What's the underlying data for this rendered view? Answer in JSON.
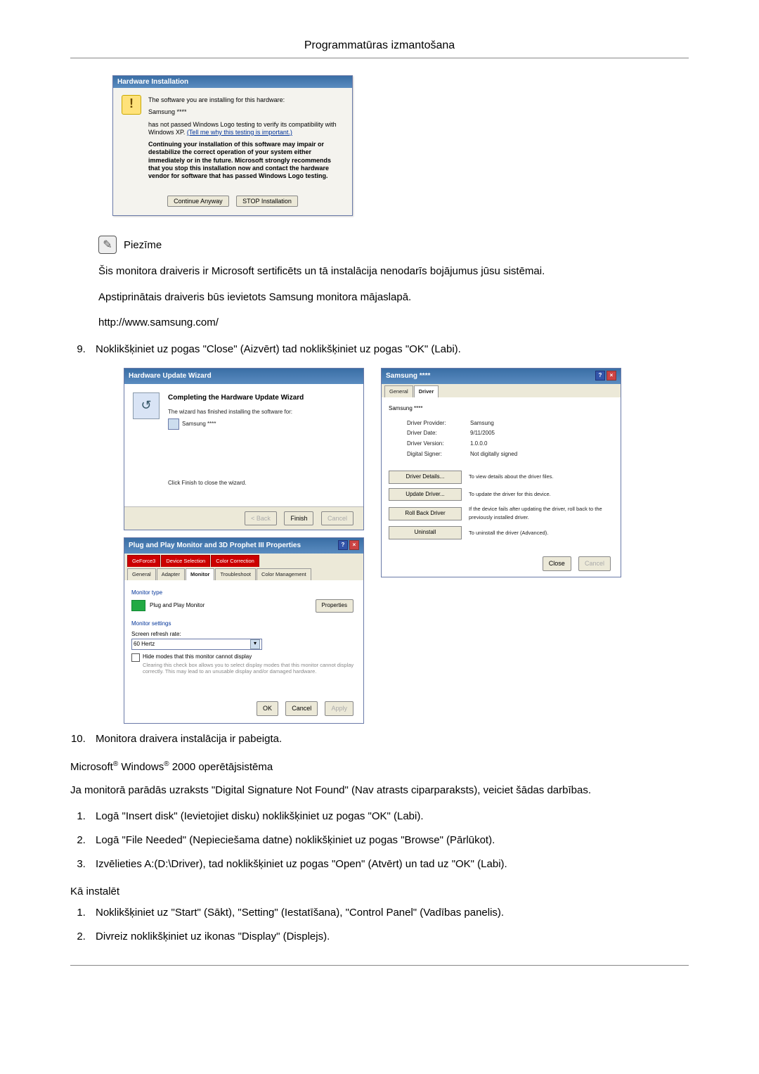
{
  "header": {
    "title": "Programmatūras izmantošana"
  },
  "hwInstall": {
    "title": "Hardware Installation",
    "line1": "The software you are installing for this hardware:",
    "device": "Samsung ****",
    "line2a": "has not passed Windows Logo testing to verify its compatibility with Windows XP. ",
    "line2link": "(Tell me why this testing is important.)",
    "warn": "Continuing your installation of this software may impair or destabilize the correct operation of your system either immediately or in the future. Microsoft strongly recommends that you stop this installation now and contact the hardware vendor for software that has passed Windows Logo testing.",
    "btn_continue": "Continue Anyway",
    "btn_stop": "STOP Installation"
  },
  "note": {
    "label": "Piezīme",
    "p1": "Šis monitora draiveris ir Microsoft sertificēts un tā instalācija nenodarīs bojājumus jūsu sistēmai.",
    "p2": "Apstiprinātais draiveris būs ievietots Samsung monitora mājaslapā.",
    "url": "http://www.samsung.com/"
  },
  "step9": "Noklikšķiniet uz pogas \"Close\" (Aizvērt) tad noklikšķiniet uz pogas \"OK\" (Labi).",
  "wizard": {
    "title": "Hardware Update Wizard",
    "heading": "Completing the Hardware Update Wizard",
    "line1": "The wizard has finished installing the software for:",
    "device": "Samsung ****",
    "line2": "Click Finish to close the wizard.",
    "btn_back": "< Back",
    "btn_finish": "Finish",
    "btn_cancel": "Cancel"
  },
  "props": {
    "title": "Plug and Play Monitor and 3D Prophet III Properties",
    "tabs_top": [
      "GeForce3",
      "Device Selection",
      "Color Correction"
    ],
    "tabs_bottom": [
      "General",
      "Adapter",
      "Monitor",
      "Troubleshoot",
      "Color Management"
    ],
    "section_type": "Monitor type",
    "monitor_name": "Plug and Play Monitor",
    "btn_properties": "Properties",
    "section_settings": "Monitor settings",
    "refresh_label": "Screen refresh rate:",
    "refresh_value": "60 Hertz",
    "hide_label": "Hide modes that this monitor cannot display",
    "hide_note": "Clearing this check box allows you to select display modes that this monitor cannot display correctly. This may lead to an unusable display and/or damaged hardware.",
    "btn_ok": "OK",
    "btn_cancel": "Cancel",
    "btn_apply": "Apply"
  },
  "driver": {
    "title": "Samsung ****",
    "tab_general": "General",
    "tab_driver": "Driver",
    "device": "Samsung ****",
    "rows": {
      "provider_k": "Driver Provider:",
      "provider_v": "Samsung",
      "date_k": "Driver Date:",
      "date_v": "9/11/2005",
      "version_k": "Driver Version:",
      "version_v": "1.0.0.0",
      "signer_k": "Digital Signer:",
      "signer_v": "Not digitally signed"
    },
    "btns": {
      "details": "Driver Details...",
      "details_d": "To view details about the driver files.",
      "update": "Update Driver...",
      "update_d": "To update the driver for this device.",
      "rollback": "Roll Back Driver",
      "rollback_d": "If the device fails after updating the driver, roll back to the previously installed driver.",
      "uninstall": "Uninstall",
      "uninstall_d": "To uninstall the driver (Advanced)."
    },
    "btn_close": "Close",
    "btn_cancel": "Cancel"
  },
  "step10": "Monitora draivera instalācija ir pabeigta.",
  "win2000_heading_a": "Microsoft",
  "win2000_heading_b": " Windows",
  "win2000_heading_c": " 2000 operētājsistēma",
  "sig_para": "Ja monitorā parādās uzraksts \"Digital Signature Not Found\" (Nav atrasts ciparparaksts), veiciet šādas darbības.",
  "sig_steps": [
    "Logā \"Insert disk\" (Ievietojiet disku) noklikšķiniet uz pogas \"OK\" (Labi).",
    "Logā \"File Needed\" (Nepieciešama datne) noklikšķiniet uz pogas \"Browse\" (Pārlūkot).",
    "Izvēlieties A:(D:\\Driver), tad noklikšķiniet uz pogas \"Open\" (Atvērt) un tad uz \"OK\" (Labi)."
  ],
  "howto_heading": "Kā instalēt",
  "howto_steps": [
    "Noklikšķiniet uz \"Start\" (Sākt), \"Setting\" (Iestatīšana), \"Control Panel\" (Vadības panelis).",
    "Divreiz noklikšķiniet uz ikonas \"Display\" (Displejs)."
  ]
}
